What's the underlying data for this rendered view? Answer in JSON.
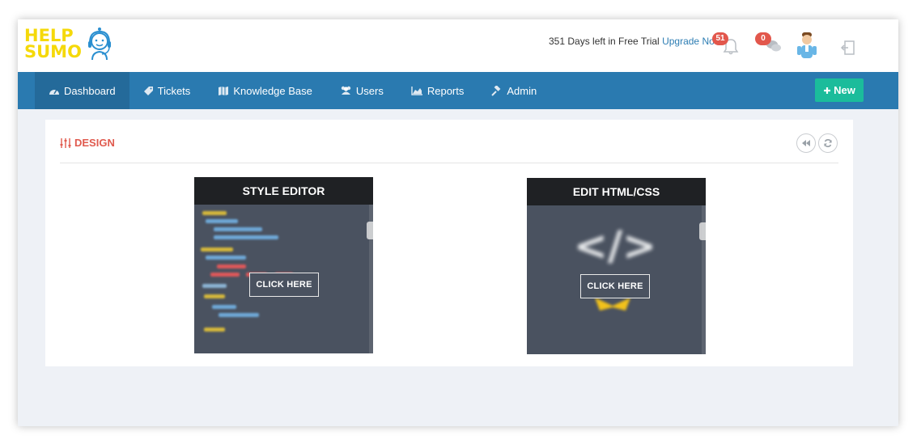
{
  "logo": {
    "line1": "HELP",
    "line2": "SUMO"
  },
  "header": {
    "trial_text": "351 Days left in Free Trial",
    "upgrade_link": "Upgrade Now",
    "notifications_count": "51",
    "messages_count": "0"
  },
  "nav": {
    "items": [
      {
        "label": "Dashboard",
        "icon": "dashboard-icon"
      },
      {
        "label": "Tickets",
        "icon": "ticket-icon"
      },
      {
        "label": "Knowledge Base",
        "icon": "map-icon"
      },
      {
        "label": "Users",
        "icon": "users-icon"
      },
      {
        "label": "Reports",
        "icon": "area-chart-icon"
      },
      {
        "label": "Admin",
        "icon": "gavel-icon"
      }
    ],
    "active": "Dashboard",
    "new_button": "New"
  },
  "panel": {
    "title": "DESIGN",
    "cards": [
      {
        "title": "STYLE EDITOR",
        "button": "CLICK HERE"
      },
      {
        "title": "EDIT HTML/CSS",
        "button": "CLICK HERE"
      }
    ]
  },
  "colors": {
    "nav_bg": "#2a7ab0",
    "nav_active": "#246a9a",
    "new_button": "#1bbc9b",
    "title_red": "#e05a4e",
    "logo_yellow": "#f5d90a",
    "badge_red": "#e2574c",
    "link_blue": "#2d7db3"
  }
}
